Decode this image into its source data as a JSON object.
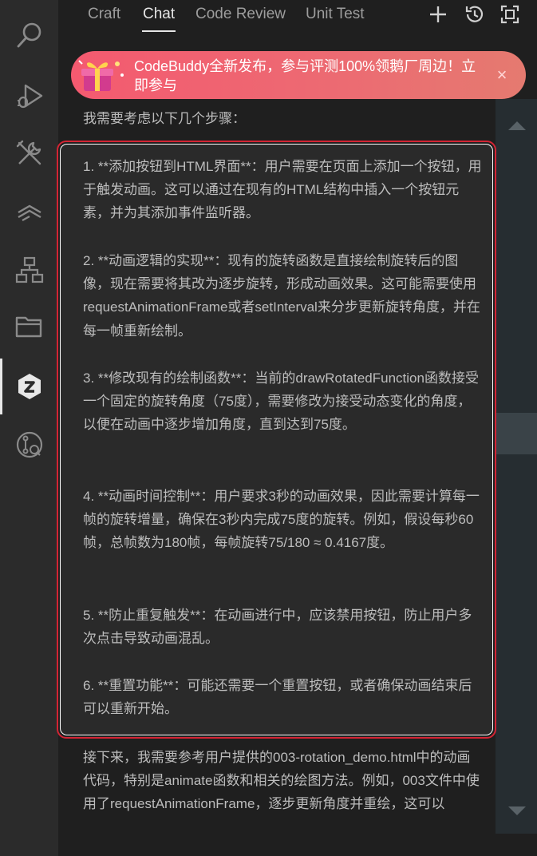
{
  "tabs": [
    {
      "label": "Craft",
      "active": false
    },
    {
      "label": "Chat",
      "active": true
    },
    {
      "label": "Code Review",
      "active": false
    },
    {
      "label": "Unit Test",
      "active": false
    }
  ],
  "top_actions": [
    "plus-icon",
    "history-icon",
    "maximize-icon"
  ],
  "activity_bar": [
    "search-icon",
    "run-debug-icon",
    "tools-icon",
    "layers-icon",
    "hierarchy-icon",
    "folder-icon",
    "codebuddy-icon",
    "git-search-icon"
  ],
  "banner": {
    "text": "CodeBuddy全新发布，参与评测100%领鹅厂周边！立即参与",
    "close": "×"
  },
  "chat": {
    "intro": "我需要考虑以下几个步骤：",
    "steps": [
      "1. **添加按钮到HTML界面**：用户需要在页面上添加一个按钮，用于触发动画。这可以通过在现有的HTML结构中插入一个按钮元素，并为其添加事件监听器。",
      "2. **动画逻辑的实现**：现有的旋转函数是直接绘制旋转后的图像，现在需要将其改为逐步旋转，形成动画效果。这可能需要使用requestAnimationFrame或者setInterval来分步更新旋转角度，并在每一帧重新绘制。",
      "3. **修改现有的绘制函数**：当前的drawRotatedFunction函数接受一个固定的旋转角度（75度），需要修改为接受动态变化的角度，以便在动画中逐步增加角度，直到达到75度。",
      "4. **动画时间控制**：用户要求3秒的动画效果，因此需要计算每一帧的旋转增量，确保在3秒内完成75度的旋转。例如，假设每秒60帧，总帧数为180帧，每帧旋转75/180 ≈ 0.4167度。",
      "5. **防止重复触发**：在动画进行中，应该禁用按钮，防止用户多次点击导致动画混乱。",
      "6. **重置功能**：可能还需要一个重置按钮，或者确保动画结束后可以重新开始。"
    ],
    "outro": "接下来，我需要参考用户提供的003-rotation_demo.html中的动画代码，特别是animate函数和相关的绘图方法。例如，003文件中使用了requestAnimationFrame，逐步更新角度并重绘，这可以"
  },
  "colors": {
    "highlight_border": "#d32434",
    "banner_start": "#f45a70",
    "banner_end": "#e57a70"
  }
}
